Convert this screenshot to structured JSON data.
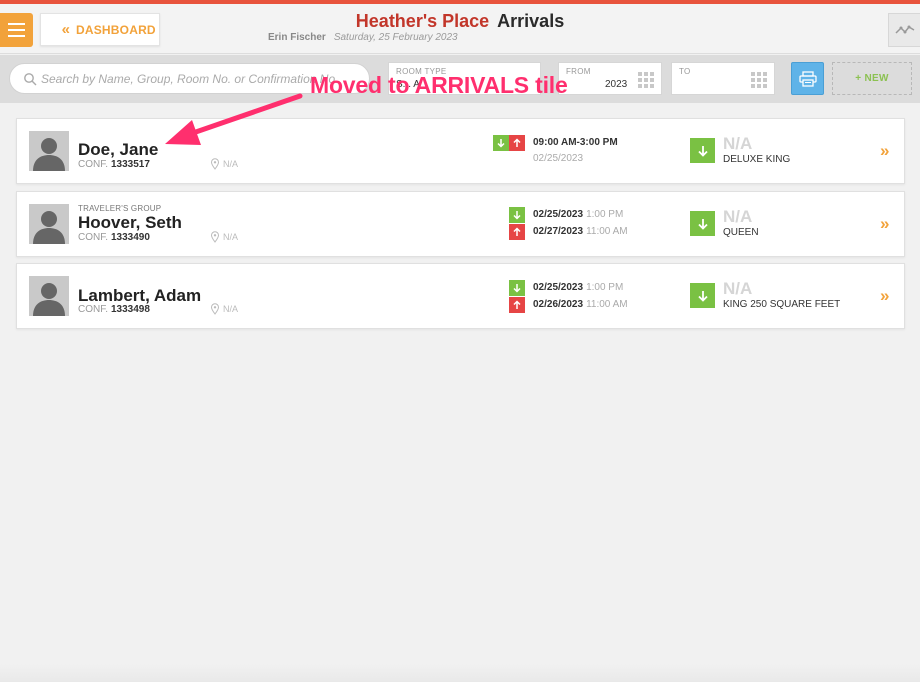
{
  "header": {
    "dashboard_label": "DASHBOARD",
    "hotel_name": "Heather's Place",
    "page_title": "Arrivals",
    "user_name": "Erin Fischer",
    "date": "Saturday, 25 February 2023"
  },
  "filters": {
    "search_placeholder": "Search by Name, Group, Room No. or Confirmation No.",
    "room_type_label": "ROOM TYPE",
    "room_type_value": "S... A",
    "from_label": "FROM",
    "from_value": "2023",
    "to_label": "TO",
    "to_value": "",
    "new_label": "+ NEW"
  },
  "annotation": {
    "text": "Moved to ARRIVALS tile",
    "color": "#ff2f6e"
  },
  "reservations": [
    {
      "group": "",
      "name": "Doe, Jane",
      "conf_label": "CONF.",
      "conf": "1333517",
      "location": "N/A",
      "time_range": "09:00 AM-3:00 PM",
      "date": "02/25/2023",
      "room_number": "N/A",
      "room_type": "DELUXE KING"
    },
    {
      "group": "TRAVELER'S GROUP",
      "name": "Hoover, Seth",
      "conf_label": "CONF.",
      "conf": "1333490",
      "location": "N/A",
      "arrival_date": "02/25/2023",
      "arrival_time": "1:00 PM",
      "departure_date": "02/27/2023",
      "departure_time": "11:00 AM",
      "room_number": "N/A",
      "room_type": "QUEEN"
    },
    {
      "group": "",
      "name": "Lambert, Adam",
      "conf_label": "CONF.",
      "conf": "1333498",
      "location": "N/A",
      "arrival_date": "02/25/2023",
      "arrival_time": "1:00 PM",
      "departure_date": "02/26/2023",
      "departure_time": "11:00 AM",
      "room_number": "N/A",
      "room_type": "KING 250 SQUARE FEET"
    }
  ],
  "colors": {
    "accent_orange": "#f2a23a",
    "hotel_red": "#c2362a",
    "arrival_green": "#7ac143",
    "departure_red": "#e64545",
    "print_blue": "#5fb3e8"
  },
  "icons": [
    "menu-icon",
    "double-chevron-left-icon",
    "activity-icon",
    "search-icon",
    "grid-icon",
    "printer-icon",
    "avatar-icon",
    "location-pin-icon",
    "arrow-down-icon",
    "arrow-up-icon",
    "double-chevron-right-icon"
  ]
}
